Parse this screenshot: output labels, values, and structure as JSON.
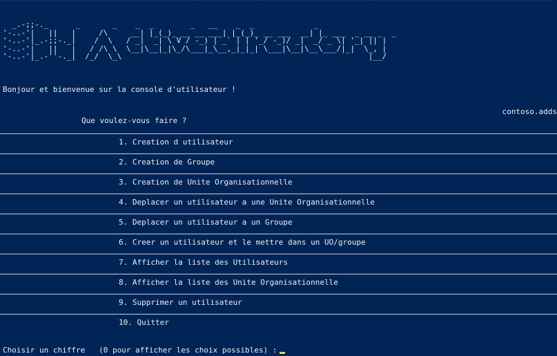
{
  "console": {
    "stars": "**************************************************************************************************************************************************************************",
    "ascii_art": "  _.-;;-._      _       _    _  _        _   __    _  _             _                \n'-..-'|   ||   |     /\\     __| |_(_)_ __ __ ___| |_(_)_ __ ___  __| |_ ___  _ __ _  _  \n'-..-'|_.-;;-._|    /  \\   / _|  _| \\ V / -_) | _` | | '_/ -_)/ _|  _/ _ \\| '_| || | \n'-..-'|   ||   |   / /\\ \\  \\__|\\__|_|\\_/\\___|_\\__,_|_|_| \\___|\\__|\\__\\___/|_|  \\_, | \n'-..-'|_.-''-._|  /_/  \\_\\                                                      |__/  ",
    "welcome": "Bonjour et bienvenue sur la console d'utilisateur !",
    "domain": "contoso.adds",
    "question": "Que voulez-vous faire ?",
    "menu": [
      {
        "label": "1. Creation d utilisateur"
      },
      {
        "label": "2. Creation de Groupe"
      },
      {
        "label": "3. Creation de Unite Organisationnelle"
      },
      {
        "label": "4. Deplacer un utilisateur a une Unite Organisationnelle"
      },
      {
        "label": "5. Deplacer un utilisateur a un Groupe"
      },
      {
        "label": "6. Creer un utilisateur et le mettre dans un UO/groupe"
      },
      {
        "label": "7. Afficher la liste des Utilisateurs"
      },
      {
        "label": "8. Afficher la liste des Unite Organisationnelle"
      },
      {
        "label": "9. Supprimer un utilisateur"
      },
      {
        "label": "10. Quitter"
      }
    ],
    "prompt": "Choisir un chiffre   (0 pour afficher les choix possibles) :"
  }
}
